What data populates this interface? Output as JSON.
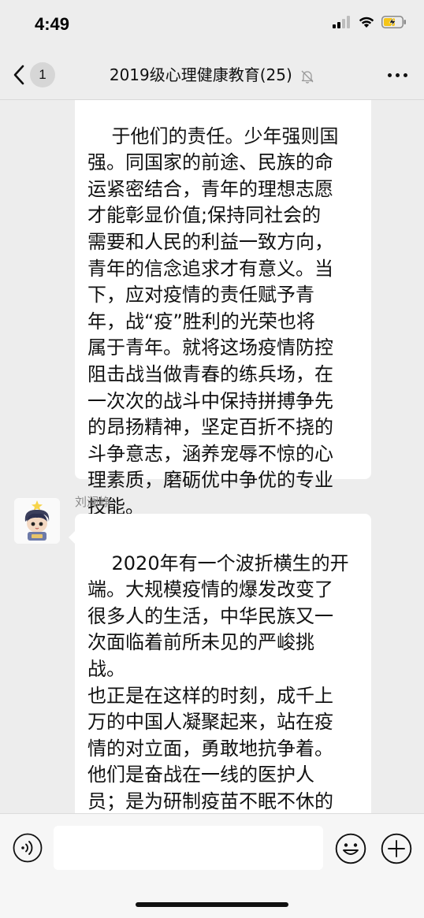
{
  "status_bar": {
    "time": "4:49",
    "icons": [
      "signal-icon",
      "wifi-icon",
      "battery-charging-icon"
    ],
    "battery_color": "#f5c518"
  },
  "header": {
    "back_icon": "chevron-left-icon",
    "unread_count": "1",
    "title": "2019级心理健康教育(25)",
    "mute_icon": "bell-off-icon",
    "more_icon": "ellipsis-icon"
  },
  "messages": [
    {
      "text": "于他们的责任。少年强则国\n强。同国家的前途、民族的命\n运紧密结合，青年的理想志愿\n才能彰显价值;保持同社会的\n需要和人民的利益一致方向，\n青年的信念追求才有意义。当\n下，应对疫情的责任赋予青\n年，战“疫”胜利的光荣也将\n属于青年。就将这场疫情防控\n阻击战当做青春的练兵场，在\n一次次的战斗中保持拼搏争先\n的昂扬精神，坚定百折不挠的\n斗争意志，涵养宠辱不惊的心\n理素质，磨砺优中争优的专业\n技能。"
    },
    {
      "sender": "刘澜峥",
      "text": "2020年有一个波折横生的开\n端。大规模疫情的爆发改变了\n很多人的生活，中华民族又一\n次面临着前所未见的严峻挑\n战。\n也正是在这样的时刻，成千上\n万的中国人凝聚起来，站在疫\n情的对立面，勇敢地抗争着。\n他们是奋战在一线的医护人\n员；是为研制疫苗不眠不休的\n科研工作者；是深入报道疫情\n进展的新闻人；是坚守阵地守"
    }
  ],
  "input_bar": {
    "voice_icon": "voice-icon",
    "input_value": "",
    "emoji_icon": "smiley-icon",
    "plus_icon": "plus-circle-icon"
  },
  "colors": {
    "background": "#ededed",
    "bubble": "#ffffff",
    "sender_name": "#888888"
  }
}
